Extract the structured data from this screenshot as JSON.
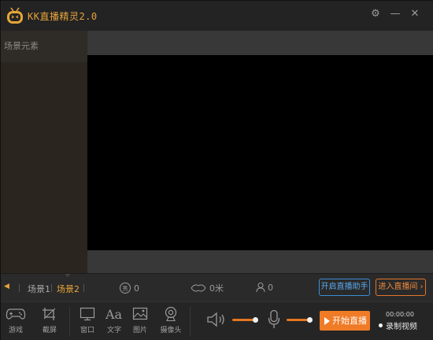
{
  "app": {
    "title": "KK直播精灵2.0"
  },
  "sidebar": {
    "header": "场景元素"
  },
  "scenes": {
    "items": [
      "场景1",
      "场景2"
    ],
    "active_index": 1
  },
  "stats": {
    "show": "0",
    "flowers": "0米",
    "viewers": "0"
  },
  "actions": {
    "assistant": "开启直播助手",
    "enter_room": "进入直播间"
  },
  "toolbar": {
    "tools": [
      {
        "label": "游戏",
        "icon": "gamepad-icon"
      },
      {
        "label": "截屏",
        "icon": "crop-icon"
      },
      {
        "label": "窗口",
        "icon": "window-icon"
      },
      {
        "label": "文字",
        "icon": "text-icon"
      },
      {
        "label": "图片",
        "icon": "image-icon"
      },
      {
        "label": "摄像头",
        "icon": "camera-icon"
      }
    ],
    "speaker_volume": 0.9,
    "mic_volume": 0.9,
    "start_label": "开始直播",
    "timer": "00:00:00",
    "record_label": "录制视频"
  },
  "colors": {
    "accent": "#f07b26",
    "brand": "#e6a43a",
    "link": "#3b8fd6"
  }
}
